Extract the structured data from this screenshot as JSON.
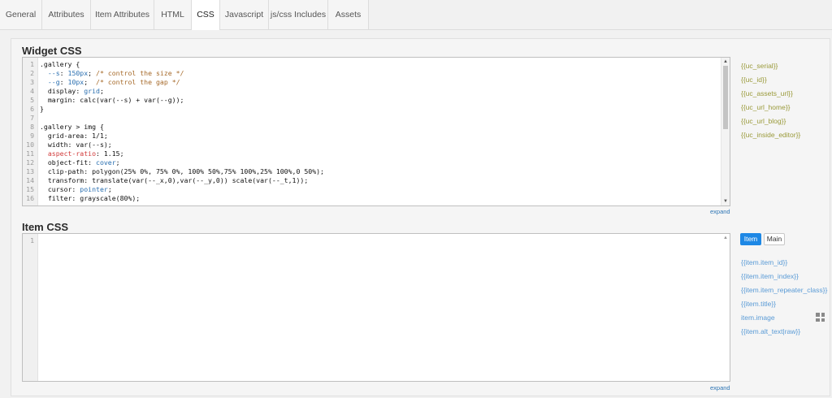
{
  "tabs": [
    "General",
    "Attributes",
    "Item Attributes",
    "HTML",
    "CSS",
    "Javascript",
    "js/css Includes",
    "Assets"
  ],
  "active_tab": "CSS",
  "widget_css": {
    "title": "Widget CSS",
    "expand_label": "expand",
    "lines": [
      {
        "n": "1",
        "t": ".gallery {"
      },
      {
        "n": "2",
        "t": "  --s: 150px; /* control the size */"
      },
      {
        "n": "3",
        "t": "  --g: 10px;  /* control the gap */"
      },
      {
        "n": "4",
        "t": "  display: grid;"
      },
      {
        "n": "5",
        "t": "  margin: calc(var(--s) + var(--g));"
      },
      {
        "n": "6",
        "t": "}"
      },
      {
        "n": "7",
        "t": ""
      },
      {
        "n": "8",
        "t": ".gallery > img {"
      },
      {
        "n": "9",
        "t": "  grid-area: 1/1;"
      },
      {
        "n": "10",
        "t": "  width: var(--s);"
      },
      {
        "n": "11",
        "t": "  aspect-ratio: 1.15;"
      },
      {
        "n": "12",
        "t": "  object-fit: cover;"
      },
      {
        "n": "13",
        "t": "  clip-path: polygon(25% 0%, 75% 0%, 100% 50%,75% 100%,25% 100%,0 50%);"
      },
      {
        "n": "14",
        "t": "  transform: translate(var(--_x,0),var(--_y,0)) scale(var(--_t,1));"
      },
      {
        "n": "15",
        "t": "  cursor: pointer;"
      },
      {
        "n": "16",
        "t": "  filter: grayscale(80%);"
      }
    ],
    "placeholders": [
      "{{uc_serial}}",
      "{{uc_id}}",
      "{{uc_assets_url}}",
      "{{uc_url_home}}",
      "{{uc_url_blog}}",
      "{{uc_inside_editor}}"
    ]
  },
  "item_css": {
    "title": "Item CSS",
    "expand_label": "expand",
    "lines": [
      {
        "n": "1",
        "t": ""
      }
    ],
    "item_button": "Item",
    "main_button": "Main",
    "placeholders": [
      "{{item.item_id}}",
      "{{item.item_index}}",
      "{{item.item_repeater_class}}",
      "{{item.title}}",
      "item.image",
      "{{item.alt_text|raw}}"
    ]
  },
  "colors": {
    "accent": "#1e88e5",
    "placeholder": "#9a9a3a",
    "item_link": "#5a9bd6",
    "link": "#2f76b5"
  },
  "icons": {
    "grid": "grid-icon",
    "scroll_up": "scroll-up-arrow-icon",
    "scroll_down": "scroll-down-arrow-icon"
  }
}
